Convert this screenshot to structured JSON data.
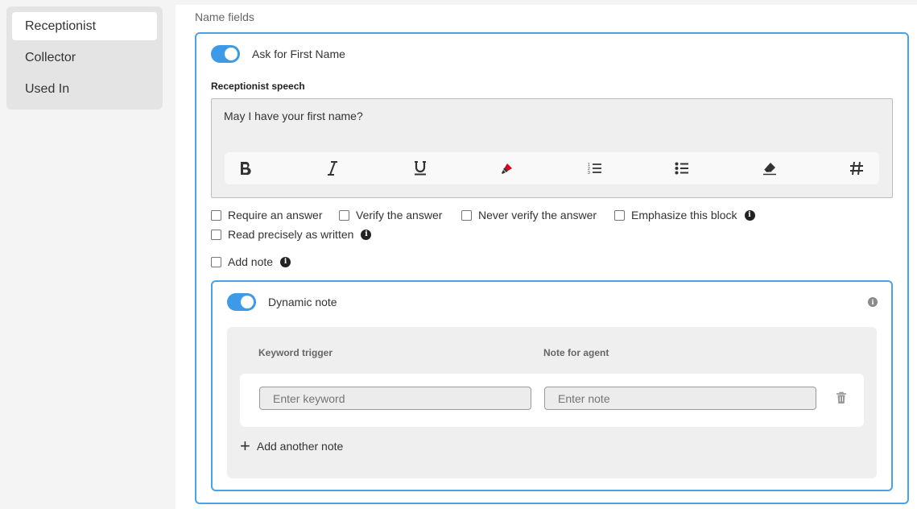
{
  "sidebar": {
    "items": [
      {
        "label": "Receptionist",
        "active": true
      },
      {
        "label": "Collector",
        "active": false
      },
      {
        "label": "Used In",
        "active": false
      }
    ]
  },
  "main": {
    "section_label": "Name fields",
    "ask_toggle": {
      "label": "Ask for First Name",
      "on": true
    },
    "speech": {
      "label": "Receptionist speech",
      "text": "May I have your first name?",
      "toolbar_icons": [
        "bold-icon",
        "italic-icon",
        "underline-icon",
        "highlighter-icon",
        "ordered-list-icon",
        "bullet-list-icon",
        "eraser-icon",
        "hash-icon"
      ]
    },
    "options": {
      "require": "Require an answer",
      "verify": "Verify the answer",
      "never_verify": "Never verify the answer",
      "emphasize": "Emphasize this block",
      "read_precisely": "Read precisely as written",
      "add_note": "Add note"
    },
    "dynamic_note": {
      "toggle_label": "Dynamic note",
      "on": true,
      "col_keyword": "Keyword trigger",
      "col_note": "Note for agent",
      "keyword_placeholder": "Enter keyword",
      "note_placeholder": "Enter note",
      "add_another": "Add another note"
    }
  },
  "colors": {
    "accent": "#3d9ae8",
    "border": "#4aa3e8",
    "highlighter": "#d9001b"
  }
}
